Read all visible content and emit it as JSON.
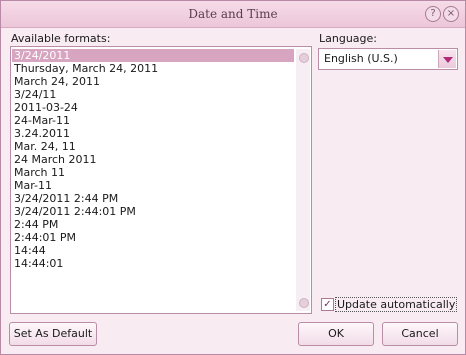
{
  "window": {
    "title": "Date and Time"
  },
  "formats": {
    "label": "Available formats:",
    "items": [
      "3/24/2011",
      "Thursday, March 24, 2011",
      "March 24, 2011",
      "3/24/11",
      "2011-03-24",
      "24-Mar-11",
      "3.24.2011",
      "Mar. 24, 11",
      "24 March 2011",
      "March 11",
      "Mar-11",
      "3/24/2011 2:44 PM",
      "3/24/2011 2:44:01 PM",
      "2:44 PM",
      "2:44:01 PM",
      "14:44",
      "14:44:01"
    ],
    "selected_index": 0
  },
  "language": {
    "label": "Language:",
    "value": "English (U.S.)"
  },
  "update": {
    "label": "Update automatically",
    "checked": true
  },
  "buttons": {
    "set_default": "Set As Default",
    "ok": "OK",
    "cancel": "Cancel"
  },
  "icons": {
    "help": "help-icon",
    "close": "close-icon",
    "dropdown": "chevron-down-icon",
    "check": "checkmark-icon"
  }
}
